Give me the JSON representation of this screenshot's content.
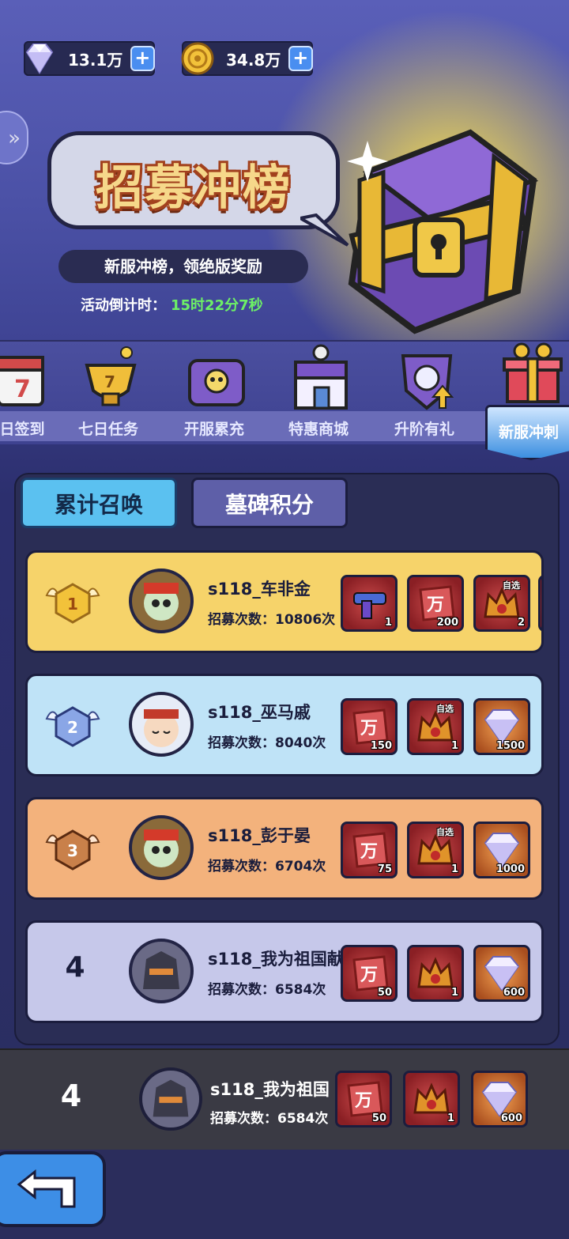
{
  "currency": {
    "diamonds": "13.1万",
    "coins": "34.8万",
    "plus": "+"
  },
  "banner": {
    "title": "招募冲榜",
    "subtitle": "新服冲榜，领绝版奖励",
    "countdown_label": "活动倒计时：",
    "countdown_value": "15时22分7秒"
  },
  "tabs": [
    {
      "label": "日签到"
    },
    {
      "label": "七日任务"
    },
    {
      "label": "开服累充"
    },
    {
      "label": "特惠商城"
    },
    {
      "label": "升阶有礼"
    },
    {
      "label": "新服冲刺"
    }
  ],
  "subtabs": [
    {
      "label": "累计召唤",
      "selected": true
    },
    {
      "label": "墓碑积分",
      "selected": false
    }
  ],
  "ranking": [
    {
      "rank": "1",
      "name": "s118_车非金",
      "count": "招募次数：10806次",
      "theme": "gold",
      "rewards": [
        {
          "icon": "gun-icon",
          "qty": "1",
          "tag": ""
        },
        {
          "icon": "wan-token-icon",
          "qty": "200",
          "tag": ""
        },
        {
          "icon": "crown-helmet-icon",
          "qty": "2",
          "tag": "自选"
        }
      ]
    },
    {
      "rank": "2",
      "name": "s118_巫马戚",
      "count": "招募次数：8040次",
      "theme": "blue",
      "rewards": [
        {
          "icon": "wan-token-icon",
          "qty": "150",
          "tag": ""
        },
        {
          "icon": "crown-helmet-icon",
          "qty": "1",
          "tag": "自选"
        },
        {
          "icon": "diamond-icon",
          "qty": "1500",
          "tag": ""
        }
      ]
    },
    {
      "rank": "3",
      "name": "s118_彭于晏",
      "count": "招募次数：6704次",
      "theme": "bronze",
      "rewards": [
        {
          "icon": "wan-token-icon",
          "qty": "75",
          "tag": ""
        },
        {
          "icon": "crown-helmet-icon",
          "qty": "1",
          "tag": "自选"
        },
        {
          "icon": "diamond-icon",
          "qty": "1000",
          "tag": ""
        }
      ]
    },
    {
      "rank": "4",
      "name": "s118_我为祖国献",
      "count": "招募次数：6584次",
      "theme": "lavender",
      "rewards": [
        {
          "icon": "wan-token-icon",
          "qty": "50",
          "tag": ""
        },
        {
          "icon": "crown-helmet-icon",
          "qty": "1",
          "tag": ""
        },
        {
          "icon": "diamond-icon",
          "qty": "600",
          "tag": ""
        }
      ]
    }
  ],
  "self": {
    "rank": "4",
    "name": "s118_我为祖国",
    "count": "招募次数：6584次",
    "rewards": [
      {
        "icon": "wan-token-icon",
        "qty": "50"
      },
      {
        "icon": "crown-helmet-icon",
        "qty": "1"
      },
      {
        "icon": "diamond-icon",
        "qty": "600"
      }
    ]
  },
  "colors": {
    "gold_card": "#f6d36a",
    "blue_card": "#bfe3f7",
    "bronze_card": "#f3b27c",
    "lavender_card": "#c6c8ea",
    "accent_blue": "#5bc1f0"
  }
}
